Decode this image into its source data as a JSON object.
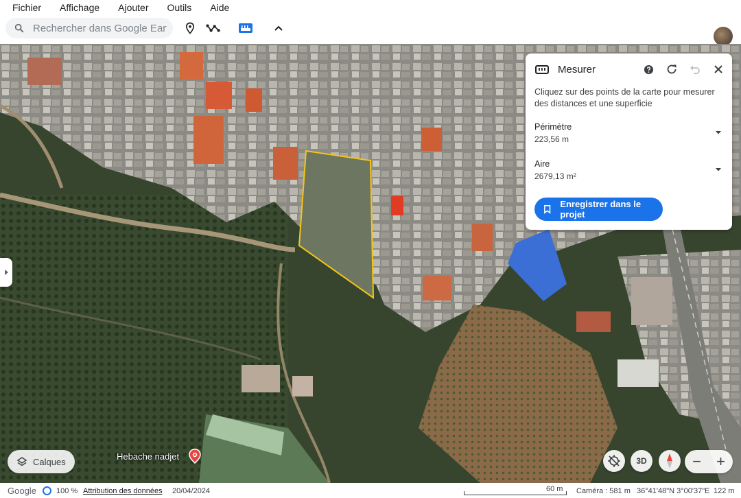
{
  "menu": {
    "items": [
      "Fichier",
      "Affichage",
      "Ajouter",
      "Outils",
      "Aide"
    ]
  },
  "search": {
    "placeholder": "Rechercher dans Google Earth"
  },
  "toolbar": {
    "icons": [
      "placemark-icon",
      "path-icon",
      "ruler-icon",
      "chevron-up-icon"
    ],
    "accent": "#1a73e8"
  },
  "panel": {
    "title": "Mesurer",
    "description": "Cliquez sur des points de la carte pour mesurer des distances et une superficie",
    "perimeter_label": "Périmètre",
    "perimeter_value": "223,56 m",
    "area_label": "Aire",
    "area_value": "2679,13 m²",
    "save_label": "Enregistrer dans le projet"
  },
  "map": {
    "layers_label": "Calques",
    "place_label": "Hebache nadjet",
    "btn_3d": "3D",
    "zoom_out": "−",
    "zoom_in": "+",
    "polygon_color": "#f5c518"
  },
  "status": {
    "brand": "Google",
    "progress": "100 %",
    "attribution": "Attribution des données",
    "date": "20/04/2024",
    "scale": "60 m",
    "camera": "Caméra : 581 m",
    "coords": "36°41'48\"N 3°00'37\"E",
    "elevation": "122 m"
  }
}
